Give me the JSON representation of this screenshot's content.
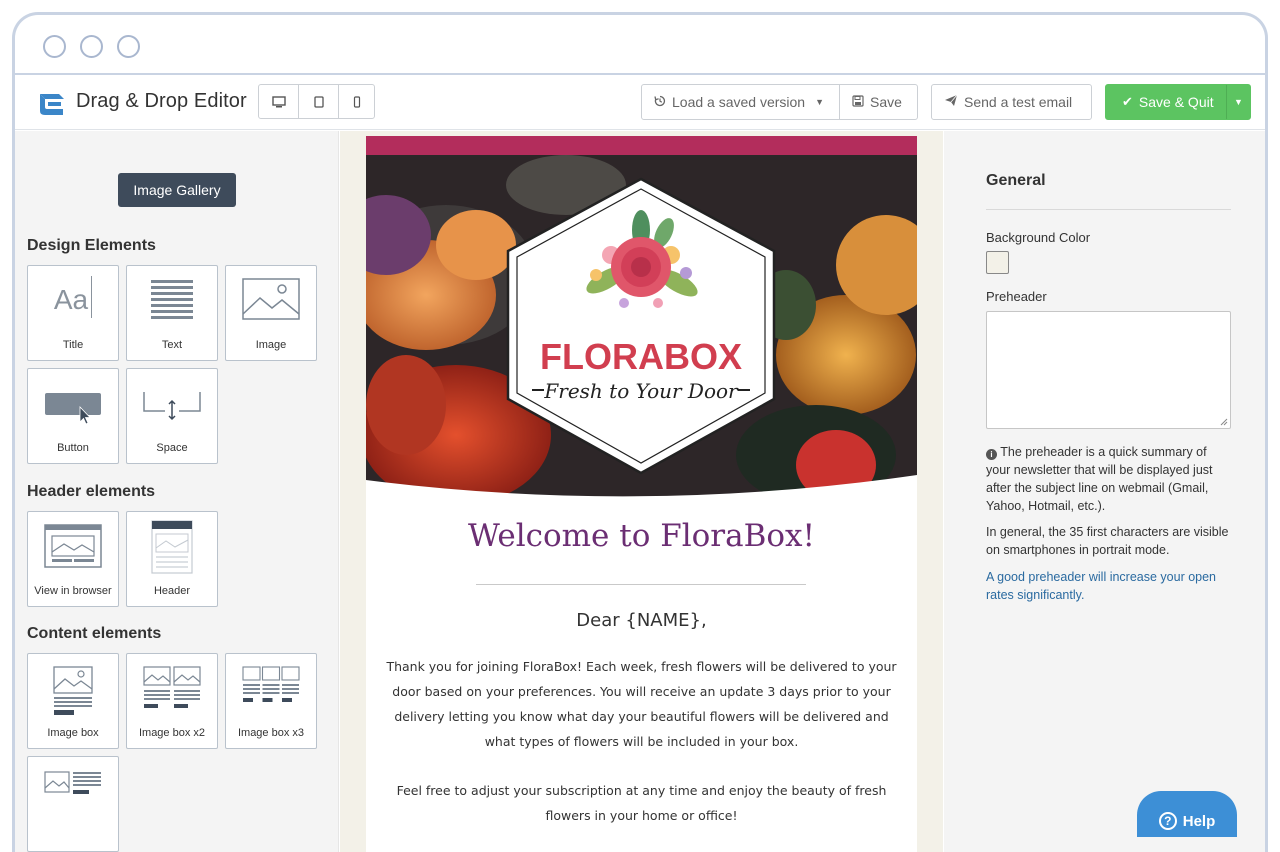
{
  "toolbar": {
    "app_title": "Drag & Drop Editor",
    "load_version_label": "Load a saved version",
    "save_label": "Save",
    "send_test_label": "Send a test email",
    "save_quit_label": "Save & Quit"
  },
  "left_panel": {
    "gallery_button": "Image Gallery",
    "design_title": "Design Elements",
    "design_items": [
      "Title",
      "Text",
      "Image",
      "Button",
      "Space"
    ],
    "header_title": "Header elements",
    "header_items": [
      "View in browser",
      "Header"
    ],
    "content_title": "Content elements",
    "content_items": [
      "Image box",
      "Image box x2",
      "Image box x3"
    ]
  },
  "email": {
    "brand_name": "FLORABOX",
    "brand_tagline": "Fresh to Your Door",
    "heading": "Welcome to FloraBox!",
    "salutation": "Dear {NAME},",
    "paragraph1": "Thank you for joining FloraBox! Each week, fresh flowers will be delivered to your door based on your preferences. You will receive an update 3 days prior to your delivery letting you know what day your beautiful flowers will be delivered and what types of flowers will be included in your box.",
    "paragraph2": "Feel free to adjust your subscription at any time and enjoy the beauty of fresh flowers in your home or office!"
  },
  "right_panel": {
    "title": "General",
    "bg_color_label": "Background Color",
    "bg_color_value": "#f3f1e8",
    "preheader_label": "Preheader",
    "info_text": "The preheader is a quick summary of your newsletter that will be displayed just after the subject line on webmail (Gmail, Yahoo, Hotmail, etc.).",
    "general_text": "In general, the 35 first characters are visible on smartphones in portrait mode.",
    "link_text": "A good preheader will increase your open rates significantly."
  },
  "help_label": "Help",
  "colors": {
    "accent_green": "#5cc461",
    "email_heading": "#6b2e73",
    "brand_red": "#d13e4f",
    "email_bar": "#b32d5c"
  }
}
